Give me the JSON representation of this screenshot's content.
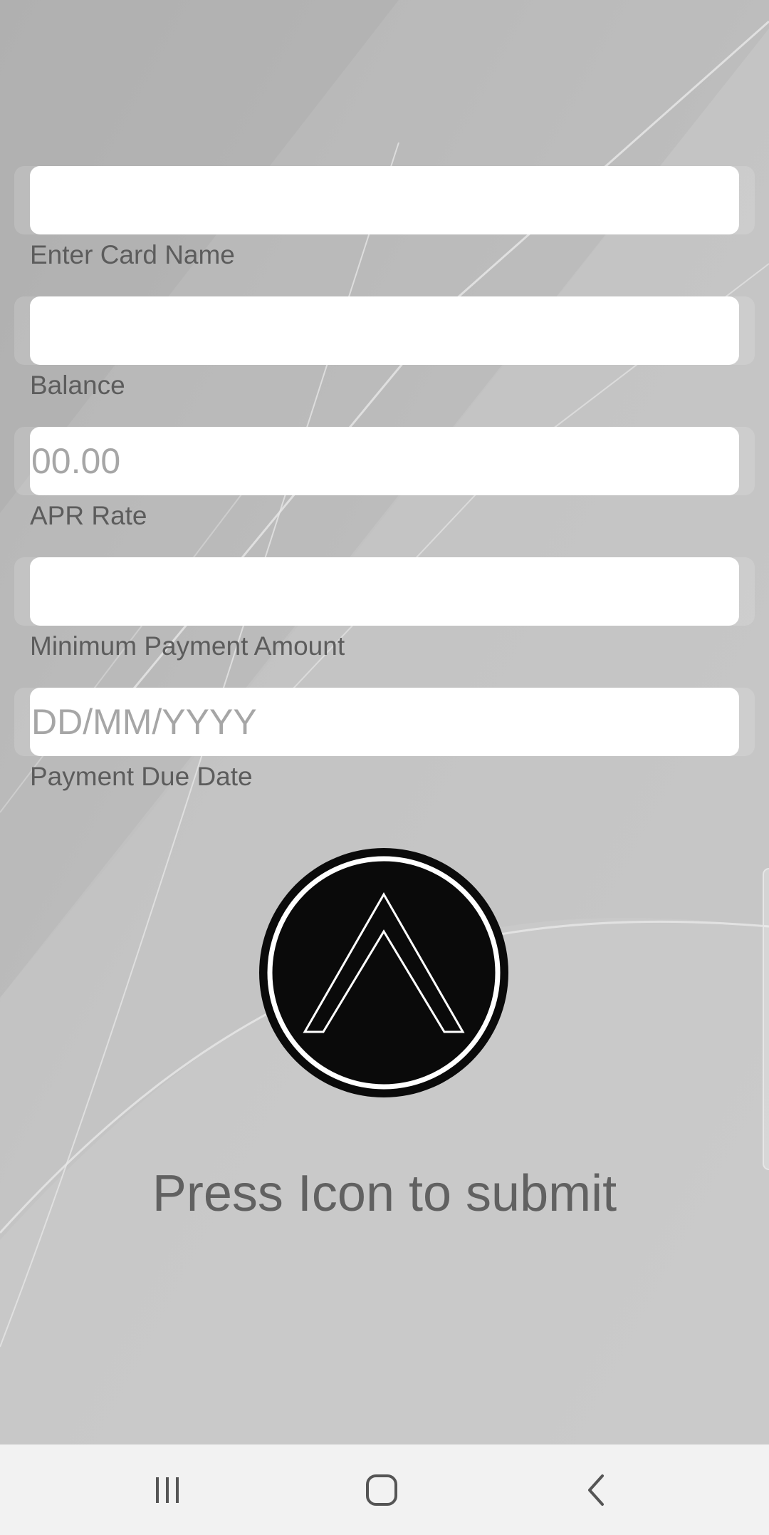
{
  "form": {
    "fields": [
      {
        "label": "Enter Card Name",
        "placeholder": "",
        "value": ""
      },
      {
        "label": "Balance",
        "placeholder": "",
        "value": ""
      },
      {
        "label": "APR Rate",
        "placeholder": "00.00",
        "value": ""
      },
      {
        "label": "Minimum Payment Amount",
        "placeholder": "",
        "value": ""
      },
      {
        "label": "Payment Due Date",
        "placeholder": "DD/MM/YYYY",
        "value": ""
      }
    ]
  },
  "submit": {
    "icon": "chevron-up-logo-icon",
    "text": "Press Icon to submit"
  },
  "navbar": {
    "recents_icon": "recents-icon",
    "home_icon": "home-icon",
    "back_icon": "back-icon"
  },
  "colors": {
    "background": "#bdbdbd",
    "input_bg": "#ffffff",
    "label_text": "#5c5c5c",
    "placeholder_text": "#a6a6a6",
    "submit_button": "#0a0a0a",
    "navbar_bg": "#f2f2f2"
  }
}
